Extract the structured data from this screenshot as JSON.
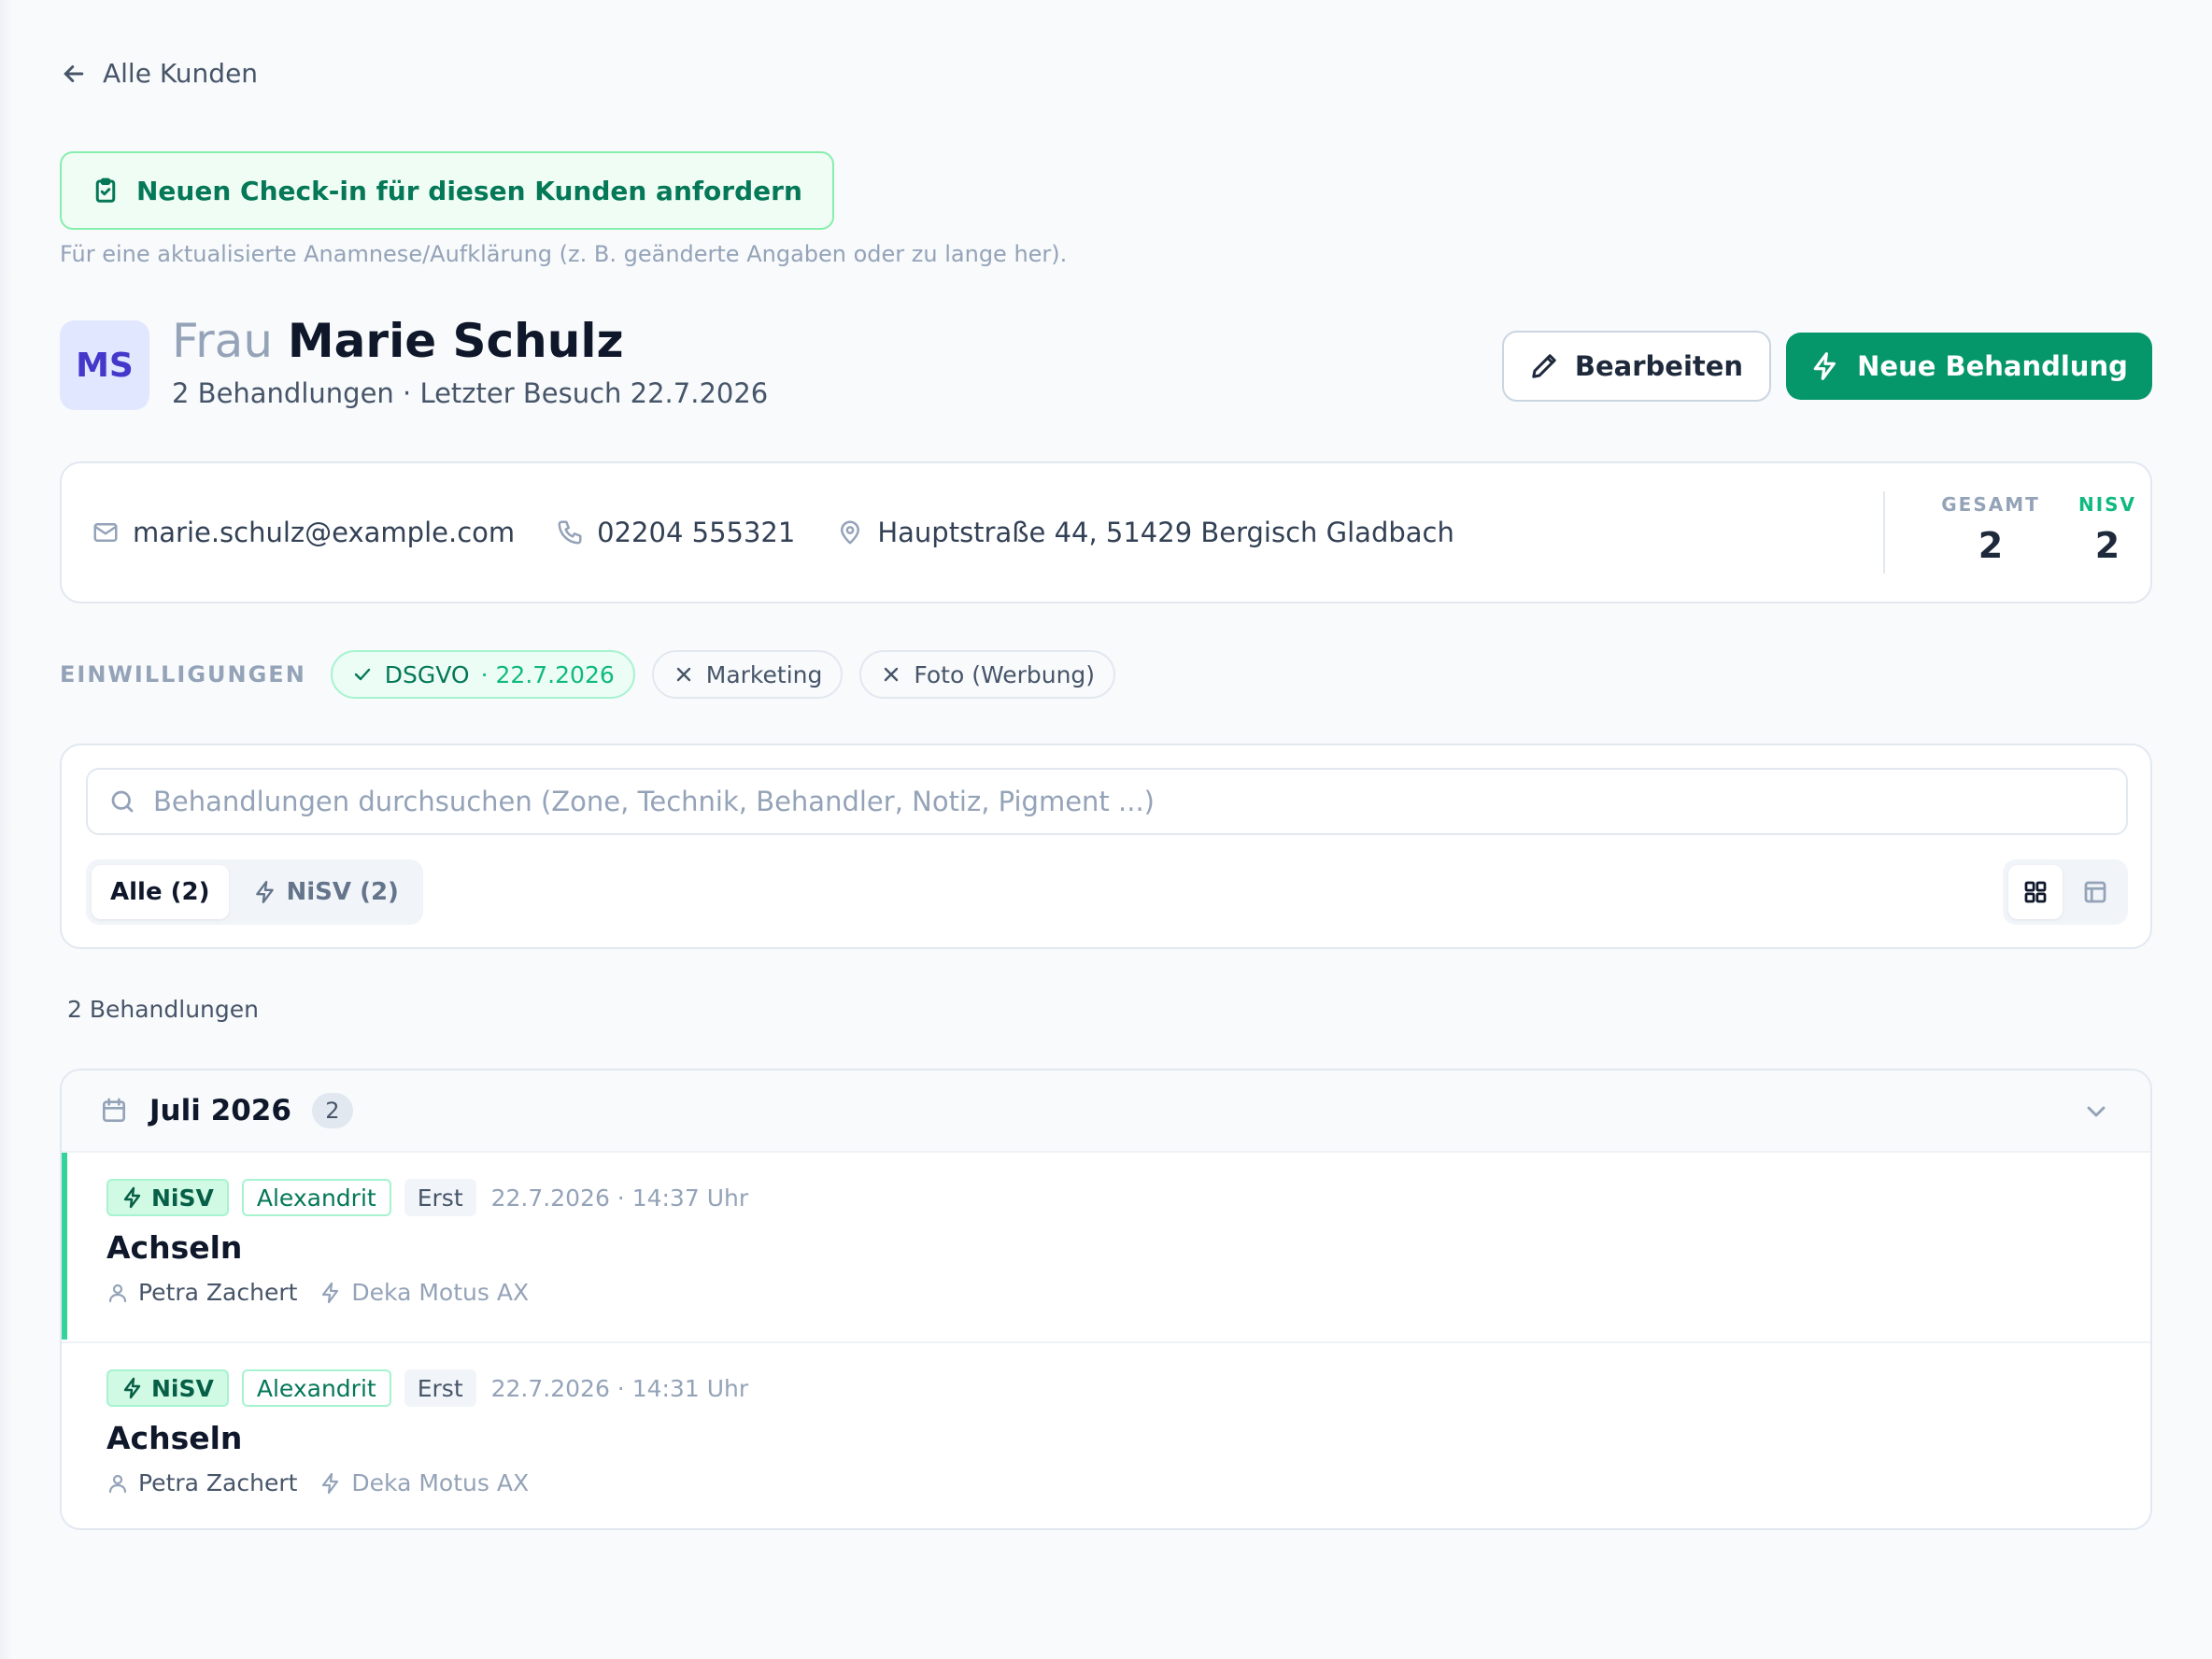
{
  "nav": {
    "back_label": "Alle Kunden"
  },
  "checkin": {
    "button_label": "Neuen Check-in für diesen Kunden anfordern",
    "hint": "Für eine aktualisierte Anamnese/Aufklärung (z. B. geänderte Angaben oder zu lange her)."
  },
  "customer": {
    "initials": "MS",
    "salutation": "Frau",
    "name": "Marie Schulz",
    "subline": "2 Behandlungen · Letzter Besuch 22.7.2026",
    "email": "marie.schulz@example.com",
    "phone": "02204 555321",
    "address": "Hauptstraße 44, 51429 Bergisch Gladbach"
  },
  "actions": {
    "edit_label": "Bearbeiten",
    "new_label": "Neue Behandlung"
  },
  "stats": {
    "total_label": "GESAMT",
    "total_value": "2",
    "nisv_label": "NISV",
    "nisv_value": "2"
  },
  "consents": {
    "label": "EINWILLIGUNGEN",
    "items": [
      {
        "name": "DSGVO",
        "date": "· 22.7.2026",
        "granted": true
      },
      {
        "name": "Marketing",
        "granted": false
      },
      {
        "name": "Foto (Werbung)",
        "granted": false
      }
    ]
  },
  "search": {
    "placeholder": "Behandlungen durchsuchen (Zone, Technik, Behandler, Notiz, Pigment ...)",
    "value": ""
  },
  "filters": [
    {
      "label": "Alle (2)",
      "active": true
    },
    {
      "label": "NiSV (2)",
      "active": false
    }
  ],
  "view_modes": {
    "grid": "grid-icon",
    "table": "table-icon",
    "active": "grid"
  },
  "result_count": "2 Behandlungen",
  "groups": [
    {
      "title": "Juli 2026",
      "count": "2",
      "expanded": true,
      "treatments": [
        {
          "badge": "NiSV",
          "device_type": "Alexandrit",
          "visit": "Erst",
          "datetime": "22.7.2026 · 14:37 Uhr",
          "zone": "Achseln",
          "practitioner": "Petra Zachert",
          "device": "Deka Motus AX"
        },
        {
          "badge": "NiSV",
          "device_type": "Alexandrit",
          "visit": "Erst",
          "datetime": "22.7.2026 · 14:31 Uhr",
          "zone": "Achseln",
          "practitioner": "Petra Zachert",
          "device": "Deka Motus AX"
        }
      ]
    }
  ],
  "colors": {
    "accent": "#059669",
    "accent_light": "#ecfdf5",
    "avatar_bg": "#e0e7ff",
    "avatar_text": "#4338ca"
  }
}
